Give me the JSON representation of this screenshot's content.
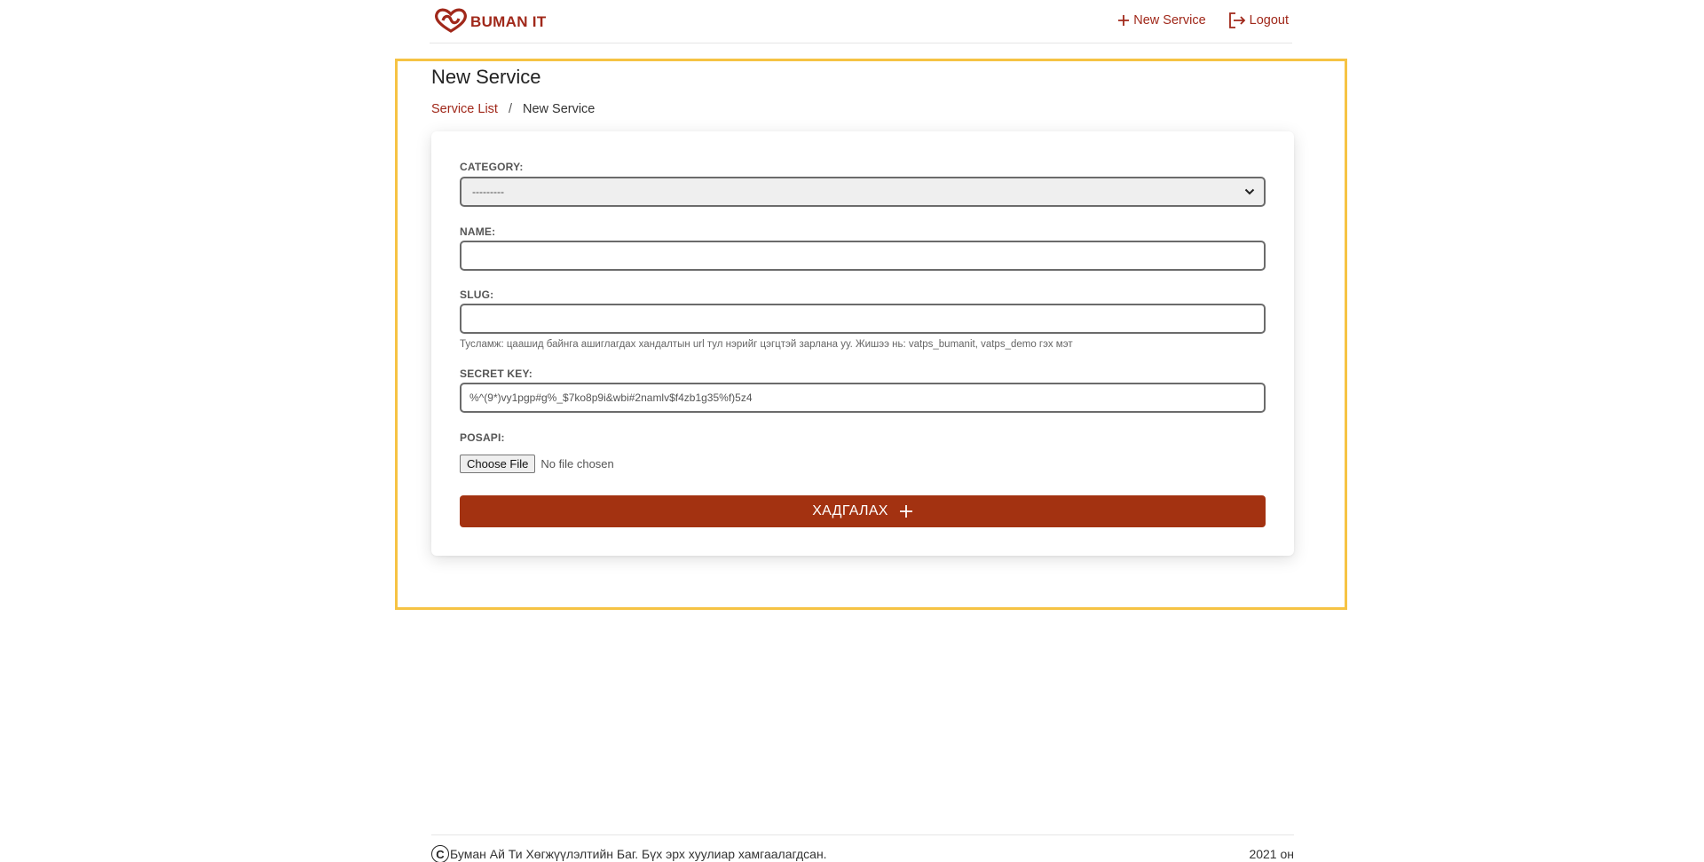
{
  "brand": {
    "name": "BUMAN IT",
    "color": "#a0281a"
  },
  "nav": {
    "new_service_label": "New Service",
    "logout_label": "Logout"
  },
  "page": {
    "title": "New Service",
    "breadcrumb": {
      "parent": "Service List",
      "separator": "/",
      "current": "New Service"
    }
  },
  "form": {
    "category": {
      "label": "CATEGORY:",
      "selected": "---------"
    },
    "name": {
      "label": "NAME:",
      "value": ""
    },
    "slug": {
      "label": "SLUG:",
      "value": "",
      "help": "Тусламж: цаашид байнга ашиглагдах хандалтын url тул нэрийг цэгцтэй зарлана уу. Жишээ нь: vatps_bumanit, vatps_demo гэх мэт"
    },
    "secret_key": {
      "label": "SECRET KEY:",
      "value": "%^(9*)vy1pgp#g%_$7ko8p9i&wbi#2namlv$f4zb1g35%f)5z4"
    },
    "posapi": {
      "label": "POSAPI:",
      "button_label": "Choose File",
      "status": "No file chosen"
    },
    "submit_label": "ХАДГАЛАХ"
  },
  "footer": {
    "copyright_symbol": "C",
    "text": "Буман Ай Ти Хөгжүүлэлтийн Баг. Бүх эрх хуулиар хамгаалагдсан.",
    "year": "2021 он"
  },
  "colors": {
    "accent": "#a33211",
    "frame": "#f6c344"
  }
}
